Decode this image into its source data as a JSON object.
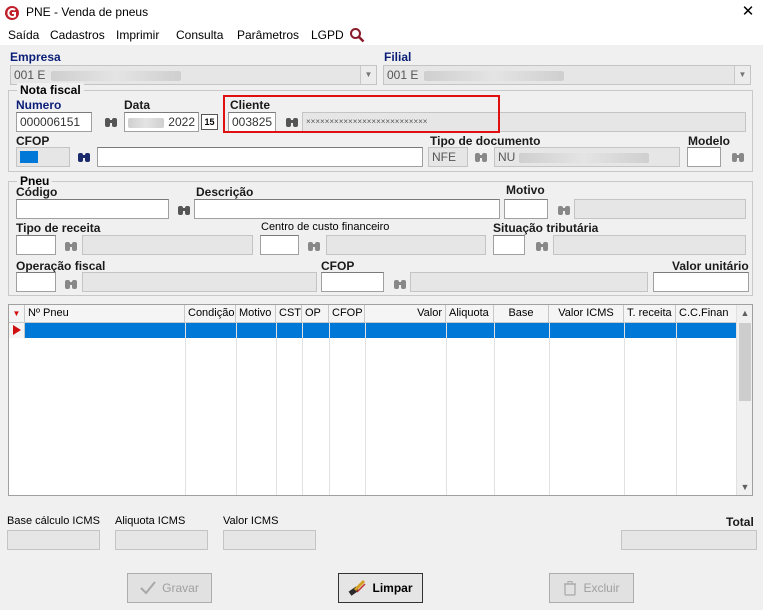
{
  "window": {
    "title": "PNE - Venda de pneus",
    "close_glyph": "✕"
  },
  "menu": {
    "items": [
      "Saída",
      "Cadastros",
      "Imprimir",
      "Consulta",
      "Parâmetros",
      "LGPD"
    ]
  },
  "empresa": {
    "label": "Empresa",
    "value": "001 E"
  },
  "filial": {
    "label": "Filial",
    "value": "001 E"
  },
  "nota_fiscal": {
    "group_title": "Nota fiscal",
    "numero_label": "Numero",
    "numero_value": "000006151",
    "data_label": "Data",
    "data_value": "2022",
    "calendar_glyph": "15",
    "cliente_label": "Cliente",
    "cliente_code": "003825",
    "cliente_name": "××××××××××××××××××××××××××",
    "cfop_label": "CFOP",
    "tipo_documento_label": "Tipo de documento",
    "tipo_documento_code": "NFE",
    "tipo_documento_name": "NU",
    "modelo_label": "Modelo"
  },
  "pneu": {
    "group_title": "Pneu",
    "codigo_label": "Código",
    "descricao_label": "Descrição",
    "motivo_label": "Motivo",
    "tipo_receita_label": "Tipo de receita",
    "centro_custo_label": "Centro de custo financeiro",
    "situacao_tributaria_label": "Situação tributária",
    "operacao_fiscal_label": "Operação fiscal",
    "cfop_label": "CFOP",
    "valor_unitario_label": "Valor unitário"
  },
  "grid": {
    "columns": [
      "Nº Pneu",
      "Condição",
      "Motivo",
      "CST",
      "OP",
      "CFOP",
      "Valor",
      "Aliquota",
      "Base",
      "Valor ICMS",
      "T. receita",
      "C.C.Finan"
    ]
  },
  "totals": {
    "base_calculo_label": "Base cálculo ICMS",
    "aliquota_label": "Aliquota ICMS",
    "valor_icms_label": "Valor ICMS",
    "total_label": "Total"
  },
  "buttons": {
    "gravar": "Gravar",
    "limpar": "Limpar",
    "excluir": "Excluir"
  },
  "colors": {
    "highlight": "#e01010",
    "selection": "#0078d7",
    "label_navy": "#0a1e78"
  }
}
